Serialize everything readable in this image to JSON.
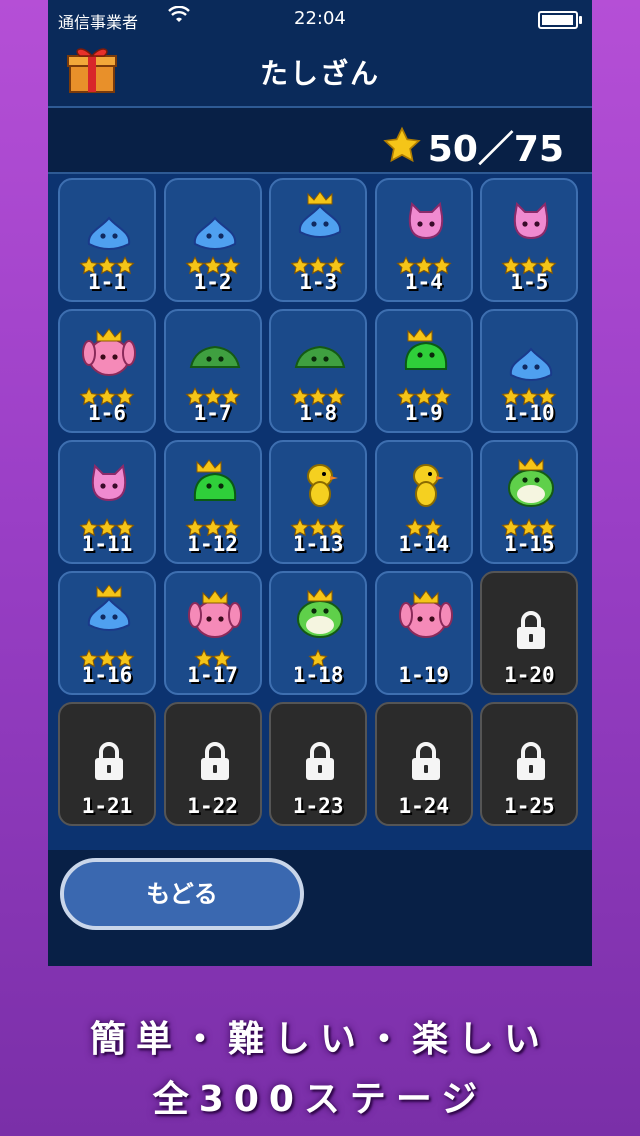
{
  "status_bar": {
    "carrier": "通信事業者",
    "time": "22:04"
  },
  "header": {
    "title": "たしざん",
    "gift_icon": "gift-icon"
  },
  "stars": {
    "text": "50／75",
    "earned": 50,
    "total": 75
  },
  "colors": {
    "panel": "#0a2a5a",
    "grid": "#0c3370",
    "cell": "#1b4a8a",
    "locked": "#2b2b2b",
    "star": "#f5c518"
  },
  "stages": [
    {
      "label": "1-1",
      "stars": 3,
      "monster": "blue-slime",
      "locked": false
    },
    {
      "label": "1-2",
      "stars": 3,
      "monster": "blue-slime",
      "locked": false
    },
    {
      "label": "1-3",
      "stars": 3,
      "monster": "crowned-blue-slime",
      "locked": false
    },
    {
      "label": "1-4",
      "stars": 3,
      "monster": "pink-cat",
      "locked": false
    },
    {
      "label": "1-5",
      "stars": 3,
      "monster": "pink-cat",
      "locked": false
    },
    {
      "label": "1-6",
      "stars": 3,
      "monster": "crowned-pink-rabbit",
      "locked": false
    },
    {
      "label": "1-7",
      "stars": 3,
      "monster": "green-flat-slime",
      "locked": false
    },
    {
      "label": "1-8",
      "stars": 3,
      "monster": "green-flat-slime",
      "locked": false
    },
    {
      "label": "1-9",
      "stars": 3,
      "monster": "crowned-green-slime",
      "locked": false
    },
    {
      "label": "1-10",
      "stars": 3,
      "monster": "blue-slime",
      "locked": false
    },
    {
      "label": "1-11",
      "stars": 3,
      "monster": "pink-cat",
      "locked": false
    },
    {
      "label": "1-12",
      "stars": 3,
      "monster": "crowned-green-slime",
      "locked": false
    },
    {
      "label": "1-13",
      "stars": 3,
      "monster": "yellow-chick",
      "locked": false
    },
    {
      "label": "1-14",
      "stars": 2,
      "monster": "yellow-chick",
      "locked": false
    },
    {
      "label": "1-15",
      "stars": 3,
      "monster": "crowned-green-frog",
      "locked": false
    },
    {
      "label": "1-16",
      "stars": 3,
      "monster": "crowned-blue-slime",
      "locked": false
    },
    {
      "label": "1-17",
      "stars": 2,
      "monster": "crowned-pink-rabbit",
      "locked": false
    },
    {
      "label": "1-18",
      "stars": 1,
      "monster": "crowned-green-frog",
      "locked": false
    },
    {
      "label": "1-19",
      "stars": 0,
      "monster": "crowned-pink-rabbit",
      "locked": false
    },
    {
      "label": "1-20",
      "stars": 0,
      "monster": "lock",
      "locked": true
    },
    {
      "label": "1-21",
      "stars": 0,
      "monster": "lock",
      "locked": true
    },
    {
      "label": "1-22",
      "stars": 0,
      "monster": "lock",
      "locked": true
    },
    {
      "label": "1-23",
      "stars": 0,
      "monster": "lock",
      "locked": true
    },
    {
      "label": "1-24",
      "stars": 0,
      "monster": "lock",
      "locked": true
    },
    {
      "label": "1-25",
      "stars": 0,
      "monster": "lock",
      "locked": true
    }
  ],
  "footer": {
    "back_label": "もどる"
  },
  "caption": {
    "line1": "簡単・難しい・楽しい",
    "line2": "全300ステージ"
  }
}
